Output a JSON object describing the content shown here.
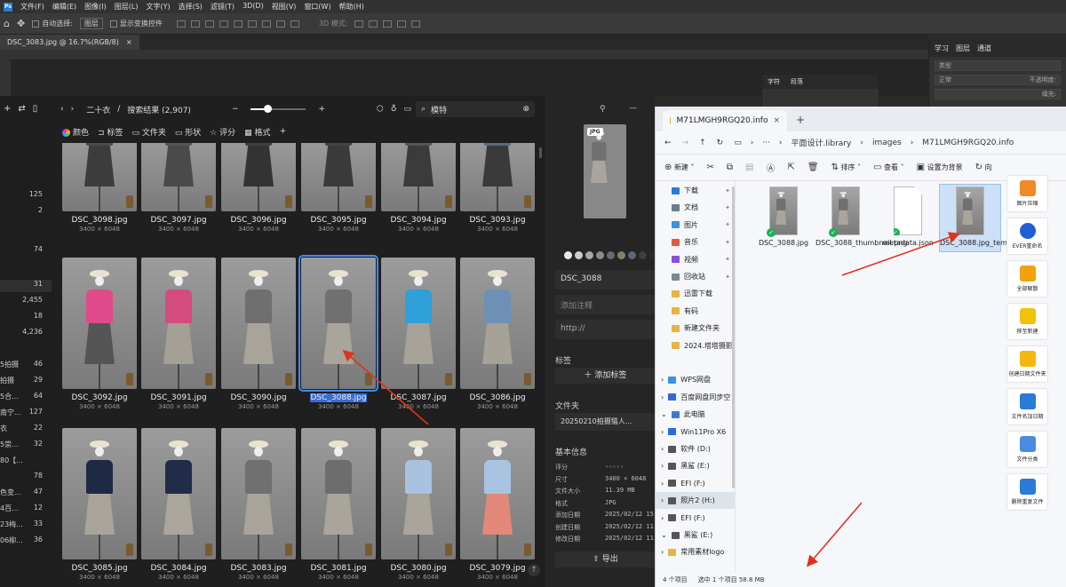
{
  "ps": {
    "logo": "Ps",
    "menu": [
      "文件(F)",
      "编辑(E)",
      "图像(I)",
      "图层(L)",
      "文字(Y)",
      "选择(S)",
      "滤镜(T)",
      "3D(D)",
      "视图(V)",
      "窗口(W)",
      "帮助(H)"
    ],
    "options": {
      "auto_select": "自动选择:",
      "auto_select_value": "图层",
      "show_transform": "显示变换控件",
      "mode_3d": "3D 模式:"
    },
    "tab": {
      "title": "DSC_3083.jpg @ 16.7%(RGB/8)",
      "close": "×"
    },
    "right_tabs": [
      "学习",
      "图层",
      "通道"
    ],
    "layer_filter": "类型",
    "blend_mode": "正常",
    "opacity_label": "不透明度:",
    "fill_label": "填充:",
    "char_tabs": [
      "字符",
      "段落"
    ]
  },
  "sidebar": {
    "items": [
      {
        "label": "",
        "count": "125"
      },
      {
        "label": "",
        "count": "2"
      },
      {
        "label": "",
        "count": "74"
      },
      {
        "label": "",
        "count": "31",
        "selected": true
      },
      {
        "label": "",
        "count": "2,455"
      },
      {
        "label": "",
        "count": "18"
      },
      {
        "label": "",
        "count": "4,236"
      },
      {
        "label": "5拍摄",
        "count": "46"
      },
      {
        "label": "拍摄",
        "count": "29"
      },
      {
        "label": "5合...",
        "count": "64"
      },
      {
        "label": "南宁...",
        "count": "127"
      },
      {
        "label": "衣",
        "count": "22"
      },
      {
        "label": "5崇...",
        "count": "32"
      },
      {
        "label": "80【...",
        "count": ""
      },
      {
        "label": "",
        "count": "78"
      },
      {
        "label": "色变...",
        "count": "47"
      },
      {
        "label": "4百...",
        "count": "12"
      },
      {
        "label": "23梅...",
        "count": "33"
      },
      {
        "label": "06柳...",
        "count": "36"
      }
    ]
  },
  "eagle": {
    "breadcrumb_folder": "二十衣",
    "breadcrumb_sep": "/",
    "breadcrumb_result": "搜索结果 (2,907)",
    "zoom_plus": "+",
    "zoom_minus": "−",
    "zoom_level": 0.3,
    "search_value": "模特",
    "filters": [
      "颜色",
      "标签",
      "文件夹",
      "形状",
      "评分",
      "格式"
    ],
    "filter_add": "+",
    "rows": [
      [
        {
          "name": "DSC_3098.jpg",
          "dim": "3400 × 6048",
          "top": "#4a4a4a",
          "skirt": "#3c3c3c"
        },
        {
          "name": "DSC_3097.jpg",
          "dim": "3400 × 6048",
          "top": "#555",
          "skirt": "#4a4a4a"
        },
        {
          "name": "DSC_3096.jpg",
          "dim": "3400 × 6048",
          "top": "#3f3f3f",
          "skirt": "#333"
        },
        {
          "name": "DSC_3095.jpg",
          "dim": "3400 × 6048",
          "top": "#444",
          "skirt": "#3a3a3a"
        },
        {
          "name": "DSC_3094.jpg",
          "dim": "3400 × 6048",
          "top": "#555",
          "skirt": "#3b3b3b"
        },
        {
          "name": "DSC_3093.jpg",
          "dim": "3400 × 6048",
          "top": "#5a6a80",
          "skirt": "#3a3a3a"
        }
      ],
      [
        {
          "name": "DSC_3092.jpg",
          "dim": "3400 × 6048",
          "top": "#e04a8a",
          "skirt": "#555"
        },
        {
          "name": "DSC_3091.jpg",
          "dim": "3400 × 6048",
          "top": "#d44b7e",
          "skirt": "#a5a096"
        },
        {
          "name": "DSC_3090.jpg",
          "dim": "3400 × 6048",
          "top": "#6f6f6f",
          "skirt": "#a8a49a"
        },
        {
          "name": "DSC_3088.jpg",
          "dim": "3400 × 6048",
          "top": "#707070",
          "skirt": "#a9a59b",
          "selected": true
        },
        {
          "name": "DSC_3087.jpg",
          "dim": "3400 × 6048",
          "top": "#2fa0d8",
          "skirt": "#a7a398"
        },
        {
          "name": "DSC_3086.jpg",
          "dim": "3400 × 6048",
          "top": "#6e90b5",
          "skirt": "#a6a297"
        }
      ],
      [
        {
          "name": "DSC_3085.jpg",
          "dim": "3400 × 6048",
          "top": "#1e2a44",
          "skirt": "#a8a49a"
        },
        {
          "name": "DSC_3084.jpg",
          "dim": "3400 × 6048",
          "top": "#202c48",
          "skirt": "#aaa69c"
        },
        {
          "name": "DSC_3083.jpg",
          "dim": "3400 × 6048",
          "top": "#707070",
          "skirt": "#a8a49a"
        },
        {
          "name": "DSC_3081.jpg",
          "dim": "3400 × 6048",
          "top": "#6d6d6d",
          "skirt": "#a9a59b"
        },
        {
          "name": "DSC_3080.jpg",
          "dim": "3400 × 6048",
          "top": "#a8c2e0",
          "skirt": "#a9a59b"
        },
        {
          "name": "DSC_3079.jpg",
          "dim": "3400 × 6048",
          "top": "#a9c3e2",
          "skirt": "#e2897a"
        }
      ]
    ]
  },
  "inspector": {
    "badge": "JPG",
    "swatches": [
      "#e8e8e8",
      "#cfcfcf",
      "#a8a8a8",
      "#8a8a8a",
      "#6a6a6a",
      "#8b7d6b",
      "#5a6878",
      "#3a3f4a",
      "#2b2b2b",
      "#b5a38a"
    ],
    "name": "DSC_3088",
    "note_placeholder": "添加注释",
    "url_placeholder": "http://",
    "tags_title": "标签",
    "add_tag": "添加标签",
    "folder_title": "文件夹",
    "folder_value": "20250210拍摄猫人...",
    "info_title": "基本信息",
    "info": [
      {
        "k": "评分",
        "v": "★★★★★"
      },
      {
        "k": "尺寸",
        "v": "3400 × 6048"
      },
      {
        "k": "文件大小",
        "v": "11.39 MB"
      },
      {
        "k": "格式",
        "v": "JPG"
      },
      {
        "k": "添加日期",
        "v": "2025/02/12 15"
      },
      {
        "k": "创建日期",
        "v": "2025/02/12 11"
      },
      {
        "k": "修改日期",
        "v": "2025/02/12 11"
      }
    ],
    "export": "导出"
  },
  "explorer": {
    "tab_title": "M71LMGH9RGQ20.info",
    "tab_close": "×",
    "new_tab": "+",
    "path": [
      "平面设计.library",
      "images",
      "M71LMGH9RGQ20.info"
    ],
    "path_more": "···",
    "commands": {
      "new": "新建",
      "sort": "排序",
      "view": "查看",
      "set_bg": "设置为背景",
      "rotate": "向"
    },
    "nav": [
      {
        "label": "下载",
        "color": "#2a7ad6",
        "pin": true
      },
      {
        "label": "文档",
        "color": "#6d7b8f",
        "pin": true
      },
      {
        "label": "图片",
        "color": "#3d8fe0",
        "pin": true
      },
      {
        "label": "音乐",
        "color": "#e05a3a",
        "pin": true
      },
      {
        "label": "视频",
        "color": "#8a4fd6",
        "pin": true
      },
      {
        "label": "回收站",
        "color": "#7a8898",
        "pin": true
      },
      {
        "label": "迅雷下载",
        "color": "#e8b341"
      },
      {
        "label": "有码",
        "color": "#e8b341"
      },
      {
        "label": "新建文件夹",
        "color": "#e8b341"
      },
      {
        "label": "2024.塔塔摄影",
        "color": "#e8b341"
      },
      {
        "label": "",
        "color": ""
      },
      {
        "label": "WPS网盘",
        "color": "#3a8fe8",
        "exp": ">"
      },
      {
        "label": "百度网盘同步空",
        "color": "#2a6ad6",
        "exp": ">"
      },
      {
        "label": "此电脑",
        "color": "#3a7ad6",
        "exp": "v"
      },
      {
        "label": "Win11Pro X6",
        "color": "#2a6ad6",
        "exp": ">"
      },
      {
        "label": "软件 (D:)",
        "color": "#555",
        "exp": ">"
      },
      {
        "label": "黑鲨 (E:)",
        "color": "#555",
        "exp": ">"
      },
      {
        "label": "EFI (F:)",
        "color": "#555",
        "exp": ">"
      },
      {
        "label": "照片2 (H:)",
        "color": "#555",
        "exp": ">",
        "selected": true
      },
      {
        "label": "EFI (F:)",
        "color": "#555",
        "exp": ">"
      },
      {
        "label": "黑鲨 (E:)",
        "color": "#555",
        "exp": "v"
      },
      {
        "label": "常用素材logo",
        "color": "#e8b341",
        "exp": ">"
      }
    ],
    "files": [
      {
        "name": "DSC_3088.jpg",
        "type": "img",
        "ok": true
      },
      {
        "name": "DSC_3088_thumbnail.png",
        "type": "img",
        "ok": true
      },
      {
        "name": "metadata.json",
        "type": "doc",
        "ok": true
      },
      {
        "name": "DSC_3088.jpg_temp.bmp",
        "type": "img",
        "selected": true
      }
    ],
    "status_count": "4 个项目",
    "status_sel": "选中 1 个项目  58.8 MB"
  },
  "tools": [
    {
      "label": "图片压缩",
      "color": "#f08a24"
    },
    {
      "label": "EVER重命名",
      "color": "#1f5fd6"
    },
    {
      "label": "全部解散",
      "color": "#f2a20c"
    },
    {
      "label": "移至新建",
      "color": "#f2c10c"
    },
    {
      "label": "创建日期文件夹",
      "color": "#f2b90c"
    },
    {
      "label": "文件名加日期",
      "color": "#2a7ad6"
    },
    {
      "label": "文件分类",
      "color": "#4a8ae0"
    },
    {
      "label": "删除重复文件",
      "color": "#2a7ad6"
    }
  ],
  "colors": {
    "accent": "#3a8bff",
    "arrow": "#e0321e"
  }
}
